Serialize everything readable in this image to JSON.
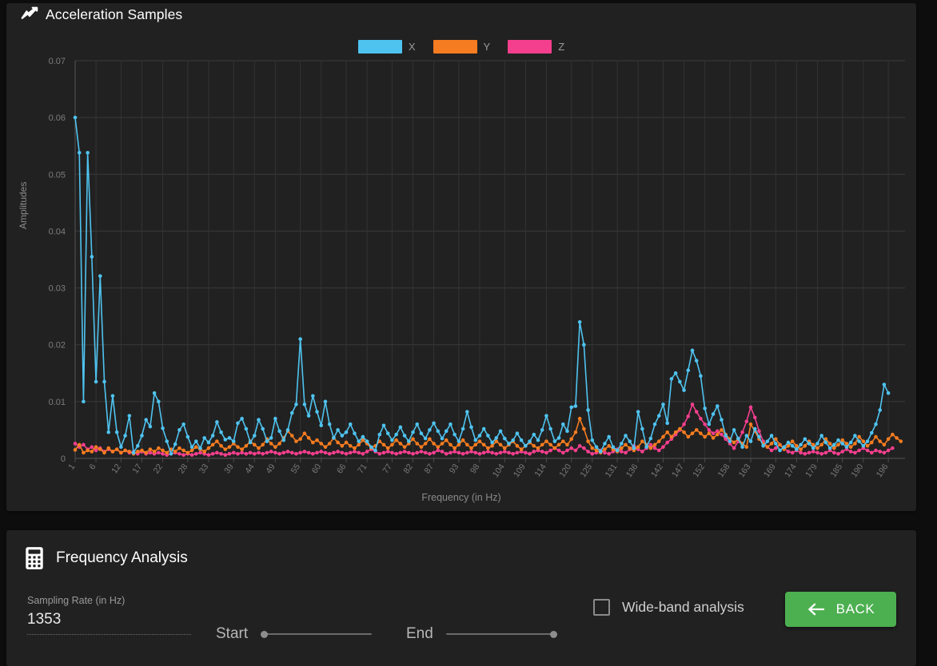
{
  "chart_card": {
    "title": "Acceleration Samples",
    "title_icon": "trending-line-icon"
  },
  "legend": {
    "items": [
      {
        "label": "X",
        "color": "#4FC3F0"
      },
      {
        "label": "Y",
        "color": "#F57C20"
      },
      {
        "label": "Z",
        "color": "#F43F8E"
      }
    ]
  },
  "analysis_card": {
    "title": "Frequency Analysis",
    "title_icon": "calculator-icon",
    "sampling_rate_label": "Sampling Rate (in Hz)",
    "sampling_rate_value": "1353",
    "start_label": "Start",
    "end_label": "End",
    "start_value": 0,
    "end_value": 100,
    "wide_band_label": "Wide-band analysis",
    "wide_band_checked": false,
    "back_label": "BACK",
    "back_icon": "arrow-left-icon",
    "back_color": "#4caf50"
  },
  "chart_data": {
    "type": "line",
    "title": "Acceleration Samples",
    "xlabel": "Frequency (in Hz)",
    "ylabel": "Amplitudes",
    "grid": true,
    "legend_position": "top-center",
    "ylim": [
      0,
      0.07
    ],
    "yticks": [
      0,
      0.01,
      0.02,
      0.03,
      0.04,
      0.05,
      0.06,
      0.07
    ],
    "ytick_labels": [
      "0",
      "0.01",
      "0.02",
      "0.03",
      "0.04",
      "0.05",
      "0.06",
      "0.07"
    ],
    "xlim": [
      1,
      200
    ],
    "xticks": [
      1,
      6,
      12,
      17,
      22,
      28,
      33,
      39,
      44,
      49,
      55,
      60,
      66,
      71,
      77,
      82,
      87,
      93,
      98,
      104,
      109,
      114,
      120,
      125,
      131,
      136,
      142,
      147,
      152,
      158,
      163,
      169,
      174,
      179,
      185,
      190,
      196
    ],
    "x": [
      1,
      2,
      3,
      4,
      5,
      6,
      7,
      8,
      9,
      10,
      11,
      12,
      13,
      14,
      15,
      16,
      17,
      18,
      19,
      20,
      21,
      22,
      23,
      24,
      25,
      26,
      27,
      28,
      29,
      30,
      31,
      32,
      33,
      34,
      35,
      36,
      37,
      38,
      39,
      40,
      41,
      42,
      43,
      44,
      45,
      46,
      47,
      48,
      49,
      50,
      51,
      52,
      53,
      54,
      55,
      56,
      57,
      58,
      59,
      60,
      61,
      62,
      63,
      64,
      65,
      66,
      67,
      68,
      69,
      70,
      71,
      72,
      73,
      74,
      75,
      76,
      77,
      78,
      79,
      80,
      81,
      82,
      83,
      84,
      85,
      86,
      87,
      88,
      89,
      90,
      91,
      92,
      93,
      94,
      95,
      96,
      97,
      98,
      99,
      100,
      101,
      102,
      103,
      104,
      105,
      106,
      107,
      108,
      109,
      110,
      111,
      112,
      113,
      114,
      115,
      116,
      117,
      118,
      119,
      120,
      121,
      122,
      123,
      124,
      125,
      126,
      127,
      128,
      129,
      130,
      131,
      132,
      133,
      134,
      135,
      136,
      137,
      138,
      139,
      140,
      141,
      142,
      143,
      144,
      145,
      146,
      147,
      148,
      149,
      150,
      151,
      152,
      153,
      154,
      155,
      156,
      157,
      158,
      159,
      160,
      161,
      162,
      163,
      164,
      165,
      166,
      167,
      168,
      169,
      170,
      171,
      172,
      173,
      174,
      175,
      176,
      177,
      178,
      179,
      180,
      181,
      182,
      183,
      184,
      185,
      186,
      187,
      188,
      189,
      190,
      191,
      192,
      193,
      194,
      195,
      196,
      197,
      198,
      199,
      200
    ],
    "series": [
      {
        "name": "X",
        "color": "#4FC3F0",
        "values": [
          0.06,
          0.0538,
          0.01,
          0.0538,
          0.0355,
          0.0135,
          0.0321,
          0.0135,
          0.0046,
          0.011,
          0.0046,
          0.002,
          0.004,
          0.0075,
          0.001,
          0.0022,
          0.004,
          0.0068,
          0.0056,
          0.0115,
          0.01,
          0.0053,
          0.003,
          0.0008,
          0.0025,
          0.005,
          0.006,
          0.0038,
          0.002,
          0.003,
          0.0018,
          0.0036,
          0.0028,
          0.004,
          0.0064,
          0.0046,
          0.0033,
          0.0036,
          0.003,
          0.0062,
          0.007,
          0.0052,
          0.0028,
          0.004,
          0.0068,
          0.0052,
          0.003,
          0.0036,
          0.007,
          0.0048,
          0.0032,
          0.005,
          0.008,
          0.0095,
          0.021,
          0.0095,
          0.0075,
          0.011,
          0.0082,
          0.0058,
          0.01,
          0.006,
          0.0036,
          0.005,
          0.004,
          0.0046,
          0.006,
          0.0044,
          0.003,
          0.0038,
          0.003,
          0.002,
          0.0014,
          0.0042,
          0.0058,
          0.0044,
          0.0032,
          0.0042,
          0.0055,
          0.004,
          0.003,
          0.0046,
          0.006,
          0.0044,
          0.0035,
          0.005,
          0.0062,
          0.0048,
          0.0035,
          0.0048,
          0.006,
          0.0042,
          0.003,
          0.0052,
          0.0082,
          0.0055,
          0.0032,
          0.004,
          0.0052,
          0.004,
          0.0028,
          0.0036,
          0.0048,
          0.0035,
          0.0026,
          0.0032,
          0.0044,
          0.0032,
          0.0022,
          0.003,
          0.0042,
          0.0032,
          0.005,
          0.0075,
          0.0052,
          0.003,
          0.0036,
          0.006,
          0.0048,
          0.009,
          0.0092,
          0.024,
          0.02,
          0.0085,
          0.0032,
          0.002,
          0.0012,
          0.0026,
          0.0038,
          0.002,
          0.0014,
          0.0026,
          0.004,
          0.003,
          0.0018,
          0.0082,
          0.0052,
          0.002,
          0.0035,
          0.006,
          0.0075,
          0.0095,
          0.0062,
          0.014,
          0.015,
          0.0135,
          0.012,
          0.0155,
          0.019,
          0.0172,
          0.0145,
          0.0088,
          0.006,
          0.0078,
          0.0092,
          0.0068,
          0.004,
          0.003,
          0.005,
          0.0035,
          0.002,
          0.004,
          0.003,
          0.0052,
          0.0038,
          0.0022,
          0.003,
          0.004,
          0.0026,
          0.0014,
          0.002,
          0.0028,
          0.0022,
          0.0016,
          0.0024,
          0.0034,
          0.0026,
          0.0018,
          0.0026,
          0.004,
          0.0028,
          0.0018,
          0.0024,
          0.0032,
          0.0026,
          0.002,
          0.0028,
          0.004,
          0.003,
          0.0022,
          0.003,
          0.0045,
          0.006,
          0.0085,
          0.013,
          0.0115
        ]
      },
      {
        "name": "Y",
        "color": "#F57C20",
        "values": [
          0.0015,
          0.0024,
          0.001,
          0.0014,
          0.0012,
          0.002,
          0.0016,
          0.001,
          0.0018,
          0.0012,
          0.0016,
          0.001,
          0.0014,
          0.0012,
          0.0008,
          0.0012,
          0.0014,
          0.001,
          0.0016,
          0.0012,
          0.0018,
          0.0014,
          0.001,
          0.0016,
          0.0012,
          0.0018,
          0.0014,
          0.001,
          0.0014,
          0.002,
          0.0016,
          0.0012,
          0.0018,
          0.0024,
          0.003,
          0.0022,
          0.0016,
          0.002,
          0.0026,
          0.002,
          0.0016,
          0.0022,
          0.003,
          0.0024,
          0.0018,
          0.0024,
          0.0034,
          0.0026,
          0.002,
          0.0026,
          0.0036,
          0.0048,
          0.004,
          0.003,
          0.0034,
          0.0044,
          0.0036,
          0.0028,
          0.0032,
          0.0026,
          0.002,
          0.0026,
          0.0036,
          0.0028,
          0.0022,
          0.0028,
          0.0022,
          0.0018,
          0.0024,
          0.0032,
          0.0026,
          0.0018,
          0.0022,
          0.003,
          0.0024,
          0.0018,
          0.0024,
          0.0032,
          0.0026,
          0.002,
          0.0026,
          0.0034,
          0.0026,
          0.002,
          0.0026,
          0.0034,
          0.0026,
          0.002,
          0.0026,
          0.0032,
          0.0024,
          0.0018,
          0.0024,
          0.0032,
          0.0024,
          0.0018,
          0.0024,
          0.003,
          0.0024,
          0.0018,
          0.0022,
          0.003,
          0.0024,
          0.0018,
          0.0024,
          0.003,
          0.0022,
          0.0016,
          0.0022,
          0.0028,
          0.0022,
          0.0018,
          0.0024,
          0.003,
          0.0024,
          0.0018,
          0.0024,
          0.003,
          0.0024,
          0.0034,
          0.0046,
          0.007,
          0.0052,
          0.003,
          0.0018,
          0.0014,
          0.001,
          0.0016,
          0.0022,
          0.0016,
          0.0012,
          0.0018,
          0.0024,
          0.0018,
          0.0014,
          0.002,
          0.003,
          0.0024,
          0.0018,
          0.0024,
          0.003,
          0.0038,
          0.0046,
          0.0038,
          0.0046,
          0.0052,
          0.0046,
          0.0038,
          0.0044,
          0.005,
          0.0044,
          0.0038,
          0.0044,
          0.0036,
          0.0042,
          0.005,
          0.0042,
          0.0034,
          0.0028,
          0.0034,
          0.0026,
          0.002,
          0.006,
          0.0048,
          0.0034,
          0.0026,
          0.002,
          0.0026,
          0.0034,
          0.0024,
          0.0016,
          0.0022,
          0.003,
          0.0022,
          0.0016,
          0.0022,
          0.003,
          0.0024,
          0.0018,
          0.0024,
          0.0034,
          0.0026,
          0.0018,
          0.0024,
          0.0032,
          0.0026,
          0.002,
          0.0026,
          0.0038,
          0.003,
          0.0022,
          0.0028,
          0.0038,
          0.003,
          0.0024,
          0.0034,
          0.0042,
          0.0036,
          0.003
        ]
      },
      {
        "name": "Z",
        "color": "#F43F8E",
        "values": [
          0.0026,
          0.002,
          0.0024,
          0.0016,
          0.002,
          0.0014,
          0.0018,
          0.0012,
          0.0016,
          0.0012,
          0.0016,
          0.001,
          0.0014,
          0.001,
          0.0012,
          0.0008,
          0.0012,
          0.0008,
          0.001,
          0.0008,
          0.001,
          0.0008,
          0.0006,
          0.0008,
          0.001,
          0.0008,
          0.0006,
          0.0008,
          0.0006,
          0.0008,
          0.001,
          0.0008,
          0.0006,
          0.0008,
          0.001,
          0.0008,
          0.0006,
          0.0008,
          0.001,
          0.0008,
          0.001,
          0.0008,
          0.001,
          0.0008,
          0.001,
          0.0008,
          0.001,
          0.0012,
          0.001,
          0.0008,
          0.001,
          0.0012,
          0.001,
          0.0008,
          0.001,
          0.0012,
          0.001,
          0.0008,
          0.001,
          0.0012,
          0.001,
          0.0008,
          0.001,
          0.0012,
          0.001,
          0.0008,
          0.001,
          0.0012,
          0.001,
          0.0008,
          0.0012,
          0.0016,
          0.0012,
          0.0008,
          0.001,
          0.0012,
          0.001,
          0.0008,
          0.001,
          0.0012,
          0.001,
          0.0008,
          0.001,
          0.0012,
          0.001,
          0.0008,
          0.001,
          0.0014,
          0.0012,
          0.0008,
          0.001,
          0.0012,
          0.001,
          0.0008,
          0.001,
          0.0012,
          0.001,
          0.0008,
          0.001,
          0.0012,
          0.001,
          0.0008,
          0.001,
          0.0012,
          0.001,
          0.0008,
          0.001,
          0.0012,
          0.001,
          0.0008,
          0.0012,
          0.0014,
          0.0012,
          0.001,
          0.0014,
          0.0018,
          0.0014,
          0.001,
          0.0014,
          0.0018,
          0.0014,
          0.0022,
          0.0018,
          0.0012,
          0.0008,
          0.001,
          0.0014,
          0.001,
          0.0008,
          0.0012,
          0.0016,
          0.0012,
          0.001,
          0.0016,
          0.0022,
          0.0016,
          0.0012,
          0.0018,
          0.0024,
          0.0018,
          0.0014,
          0.002,
          0.0028,
          0.0034,
          0.0042,
          0.005,
          0.006,
          0.0074,
          0.0095,
          0.0082,
          0.007,
          0.006,
          0.005,
          0.0044,
          0.0048,
          0.0042,
          0.0034,
          0.0026,
          0.0018,
          0.003,
          0.0046,
          0.0065,
          0.009,
          0.0072,
          0.0048,
          0.003,
          0.002,
          0.0014,
          0.0018,
          0.0024,
          0.0018,
          0.0012,
          0.001,
          0.0014,
          0.001,
          0.0008,
          0.001,
          0.0012,
          0.001,
          0.0008,
          0.001,
          0.0014,
          0.001,
          0.0008,
          0.0012,
          0.0016,
          0.0012,
          0.001,
          0.0014,
          0.0018,
          0.0014,
          0.001,
          0.0014,
          0.0012,
          0.001,
          0.0014,
          0.0018
        ]
      }
    ]
  }
}
